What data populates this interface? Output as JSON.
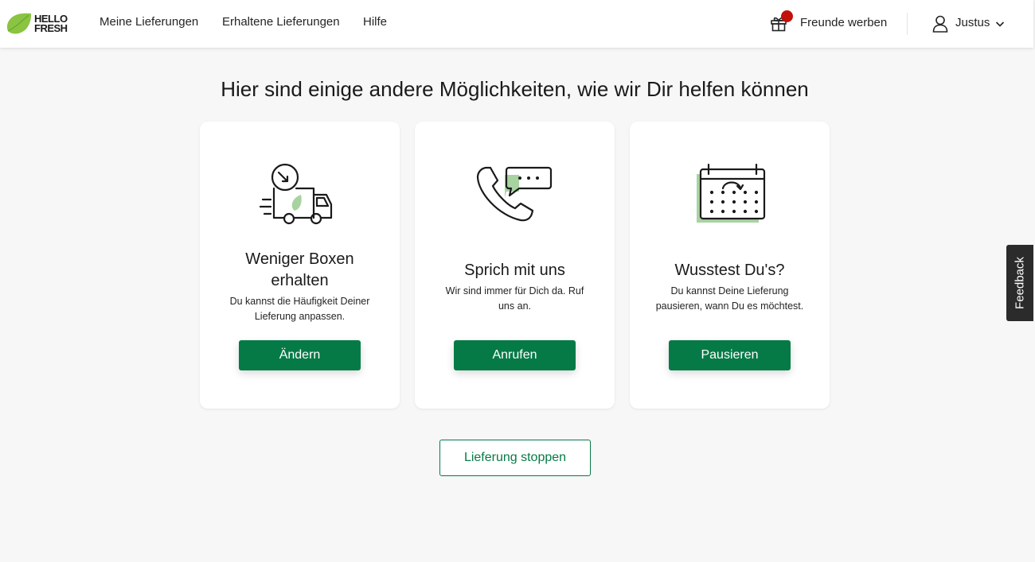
{
  "header": {
    "logo_line1": "HELLO",
    "logo_line2": "FRESH",
    "nav": [
      "Meine Lieferungen",
      "Erhaltene Lieferungen",
      "Hilfe"
    ],
    "refer_label": "Freunde werben",
    "user_name": "Justus"
  },
  "main": {
    "heading": "Hier sind einige andere Möglichkeiten, wie wir Dir helfen können",
    "cards": [
      {
        "icon": "delivery-truck-icon",
        "title": "Weniger Boxen erhalten",
        "description": "Du kannst die Häufigkeit Deiner Lieferung anpassen.",
        "button": "Ändern"
      },
      {
        "icon": "phone-chat-icon",
        "title": "Sprich mit uns",
        "description": "Wir sind immer für Dich da. Ruf uns an.",
        "button": "Anrufen"
      },
      {
        "icon": "calendar-icon",
        "title": "Wusstest Du's?",
        "description": "Du kannst Deine Lieferung pausieren, wann Du es möchtest.",
        "button": "Pausieren"
      }
    ],
    "stop_button": "Lieferung stoppen"
  },
  "feedback_tab": "Feedback",
  "colors": {
    "brand_green": "#067a46",
    "lime": "#8ac441",
    "notification": "#c2100b",
    "icon_accent": "#a8d3a0"
  }
}
